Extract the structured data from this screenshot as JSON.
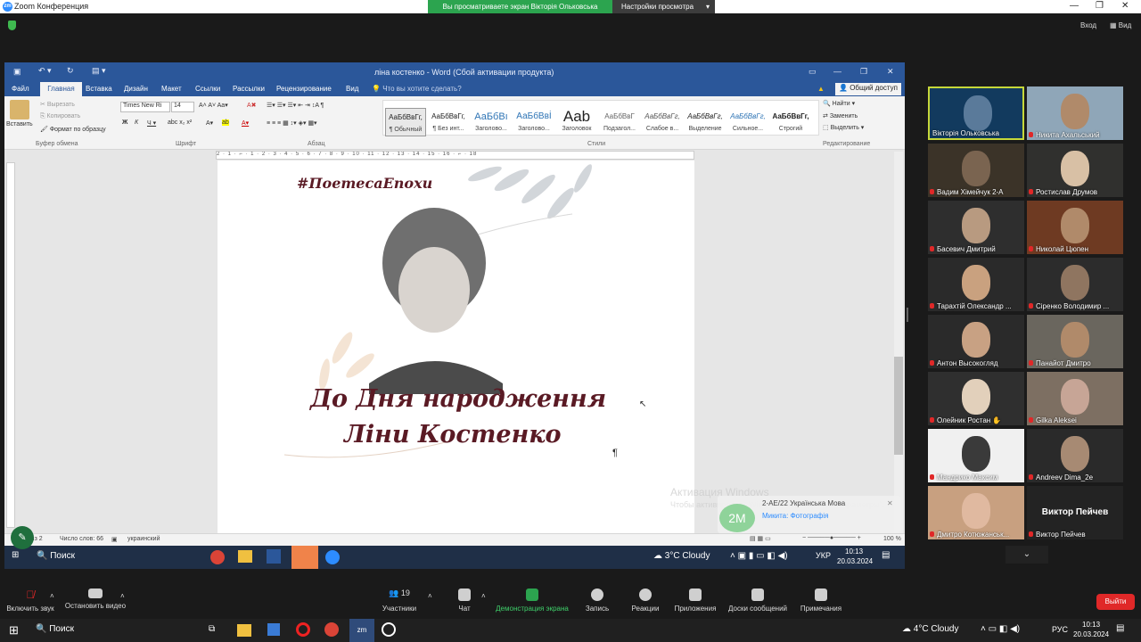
{
  "zoom": {
    "title": "Zoom Конференция",
    "sharing_banner": "Вы просматриваете экран Вікторія Ольковська",
    "view_options": "Настройки просмотра",
    "enter": "Вход",
    "view": "Вид"
  },
  "word": {
    "title": "ліна костенко - Word (Сбой активации продукта)",
    "tabs": [
      "Файл",
      "Главная",
      "Вставка",
      "Дизайн",
      "Макет",
      "Ссылки",
      "Рассылки",
      "Рецензирование",
      "Вид"
    ],
    "tell_me": "Что вы хотите сделать?",
    "share": "Общий доступ",
    "clipboard": {
      "paste": "Вставить",
      "cut": "Вырезать",
      "copy": "Копировать",
      "format": "Формат по образцу",
      "group": "Буфер обмена"
    },
    "font": {
      "name": "Times New Ri",
      "size": "14",
      "group": "Шрифт"
    },
    "paragraph_group": "Абзац",
    "styles": [
      {
        "preview": "АаБбВвГг,",
        "name": "¶ Обычный"
      },
      {
        "preview": "АаБбВвГг,",
        "name": "¶ Без инт..."
      },
      {
        "preview": "АаБбВı",
        "name": "Заголово..."
      },
      {
        "preview": "АаБбВвİ",
        "name": "Заголово..."
      },
      {
        "preview": "Aab",
        "name": "Заголовок"
      },
      {
        "preview": "АаБбВвГ",
        "name": "Подзагол..."
      },
      {
        "preview": "АаБбВвГг,",
        "name": "Слабое в..."
      },
      {
        "preview": "АаБбВвГг,",
        "name": "Выделение"
      },
      {
        "preview": "АаБбВвГг,",
        "name": "Сильное..."
      },
      {
        "preview": "АаБбВвГг,",
        "name": "Строгий"
      }
    ],
    "styles_group": "Стили",
    "editing": {
      "find": "Найти",
      "replace": "Заменить",
      "select": "Выделить",
      "group": "Редактирование"
    },
    "ruler": "2 · 1 · ⌐ · 1 · 2 · 3 · 4 · 5 · 6 · 7 · 8 · 9 · 10 · 11 · 12 · 13 · 14 · 15 · 16 · ⌐ · 18",
    "doc": {
      "hashtag": "#ПоетесаЕпохи",
      "line1": "До Дня народження",
      "line2": "Ліни Костенко",
      "mark": "¶"
    },
    "status": {
      "page": "ца 1 из 2",
      "words": "Число слов: 66",
      "lang": "украинский",
      "zoom": "100 %"
    },
    "taskbar": {
      "search": "Поиск",
      "weather": "3°C Cloudy",
      "lang": "УКР",
      "time": "10:13",
      "date": "20.03.2024"
    },
    "activation_title": "Активация Windows",
    "activation_text": "Чтобы активировать Windows, перейдите в \"Параметры\".",
    "notification": {
      "avatar": "2М",
      "line1": "2-АЕ/22 Українська Мова",
      "line2": "Микита: Фотографія"
    }
  },
  "participants": [
    {
      "name": "Вікторія Ольковська"
    },
    {
      "name": "Никита Ахальський"
    },
    {
      "name": "Вадим Хімейчук 2-А"
    },
    {
      "name": "Ростислав Друмов"
    },
    {
      "name": "Басевич Дмитрий"
    },
    {
      "name": "Николай Цюпен"
    },
    {
      "name": "Тарахтій Олександр ..."
    },
    {
      "name": "Сіренко Володимир ..."
    },
    {
      "name": "Антон Высокогляд"
    },
    {
      "name": "Панайот Дмитро"
    },
    {
      "name": "Олейник Ростан ✋"
    },
    {
      "name": "Gilka Aleksei"
    },
    {
      "name": "Мандрико Максим"
    },
    {
      "name": "Andreev Dima_2e"
    },
    {
      "name": "Дмитро Котюжанськ..."
    },
    {
      "name": "Виктор Пейчев"
    }
  ],
  "big_name": "Виктор Пейчев",
  "toolbar": {
    "unmute": "Включить звук",
    "video": "Остановить видео",
    "participants": "Участники",
    "count": "19",
    "chat": "Чат",
    "share": "Демонстрация экрана",
    "record": "Запись",
    "reactions": "Реакции",
    "apps": "Приложения",
    "whiteboards": "Доски сообщений",
    "notes": "Примечания",
    "leave": "Выйти"
  },
  "outer_taskbar": {
    "search": "Поиск",
    "weather": "4°C Cloudy",
    "lang": "РУС",
    "time": "10:13",
    "date": "20.03.2024"
  }
}
